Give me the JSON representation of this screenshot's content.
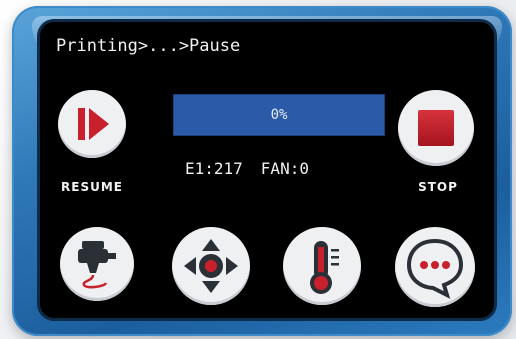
{
  "header": {
    "breadcrumb": "Printing>...>Pause"
  },
  "progress": {
    "percent": 0,
    "label": "0%"
  },
  "status": {
    "extruder": "E1:217",
    "fan": "FAN:0"
  },
  "buttons": {
    "resume": {
      "label": "RESUME",
      "icon": "play-resume-icon"
    },
    "stop": {
      "label": "STOP",
      "icon": "stop-icon"
    },
    "extrude": {
      "icon": "extruder-icon"
    },
    "move": {
      "icon": "move-axis-icon"
    },
    "temperature": {
      "icon": "thermometer-icon"
    },
    "more": {
      "icon": "more-icon"
    }
  },
  "colors": {
    "accent_red": "#c9212c",
    "progress_blue": "#2b5aa8",
    "bezel_blue": "#2f78b8",
    "button_bg": "#eef0f2"
  }
}
